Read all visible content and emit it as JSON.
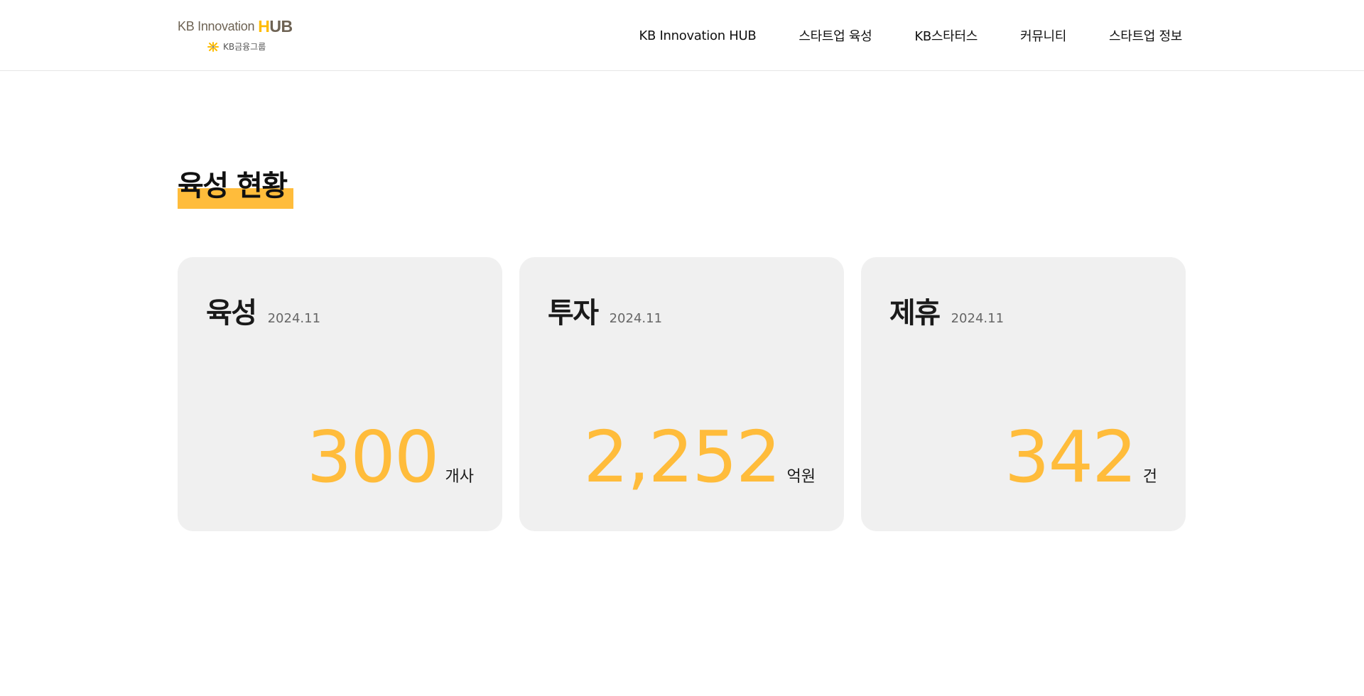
{
  "header": {
    "logo": {
      "brand_text": "KB Innovation",
      "hub_first": "H",
      "hub_rest": "UB",
      "group_text": "KB금융그룹",
      "star_icon": "kb-star-icon"
    },
    "nav": [
      {
        "label": "KB Innovation HUB"
      },
      {
        "label": "스타트업 육성"
      },
      {
        "label": "KB스타터스"
      },
      {
        "label": "커뮤니티"
      },
      {
        "label": "스타트업 정보"
      }
    ]
  },
  "main": {
    "section_title": "육성 현황",
    "cards": [
      {
        "title": "육성",
        "date": "2024.11",
        "value": "300",
        "unit": "개사"
      },
      {
        "title": "투자",
        "date": "2024.11",
        "value": "2,252",
        "unit": "억원"
      },
      {
        "title": "제휴",
        "date": "2024.11",
        "value": "342",
        "unit": "건"
      }
    ]
  },
  "colors": {
    "accent": "#ffbc3b",
    "logo_brown": "#6e6354",
    "card_bg": "#f0f0f0",
    "text": "#1a1a1a"
  }
}
